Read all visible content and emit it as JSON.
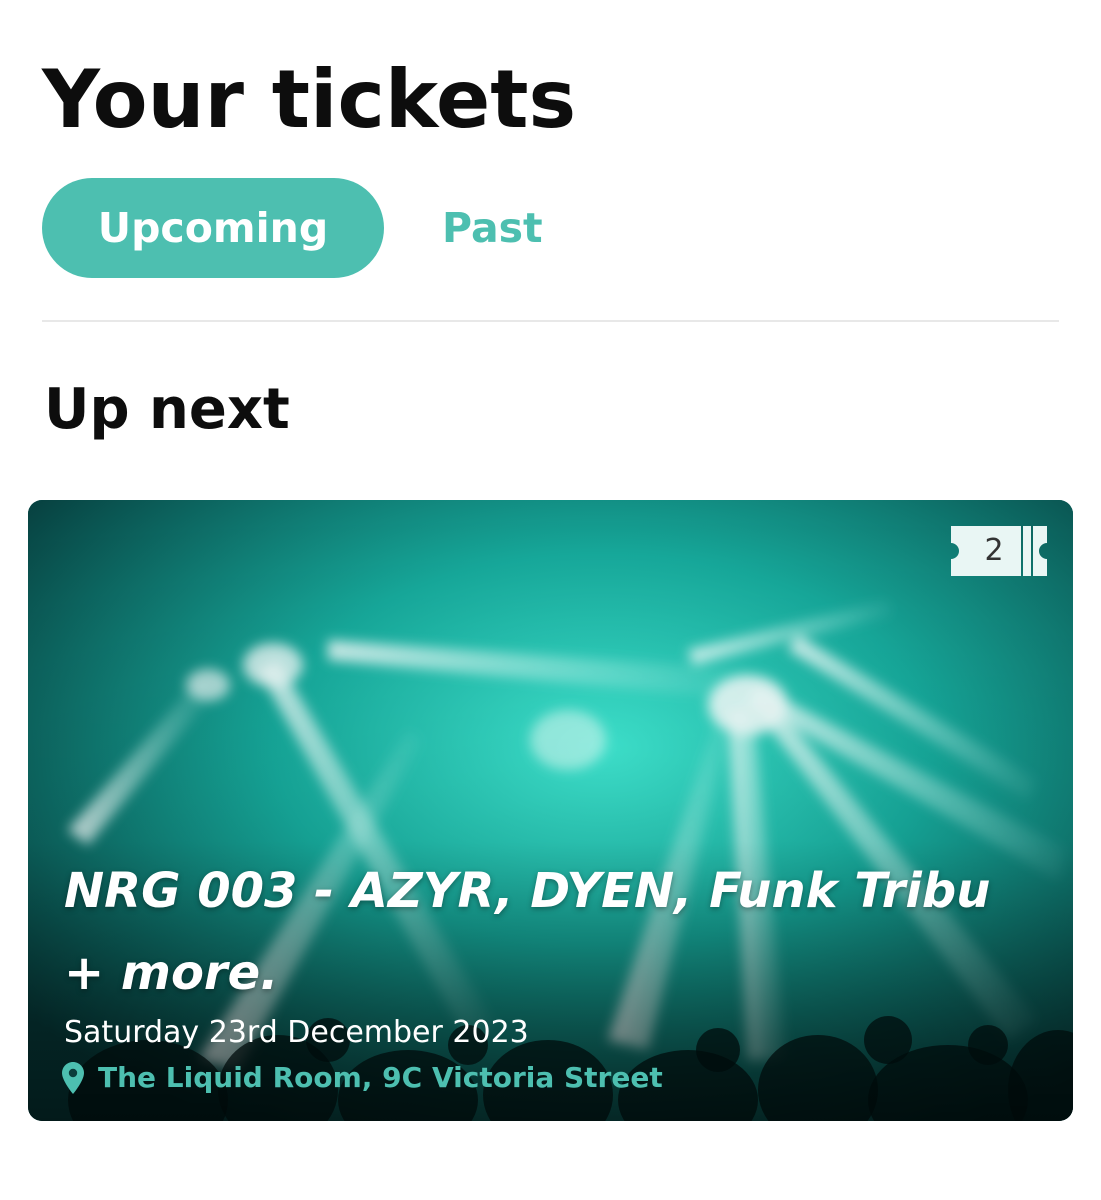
{
  "header": {
    "title": "Your tickets"
  },
  "tabs": [
    {
      "label": "Upcoming",
      "active": true
    },
    {
      "label": "Past",
      "active": false
    }
  ],
  "section": {
    "title": "Up next"
  },
  "event": {
    "title": "NRG 003 - AZYR, DYEN, Funk Tribu + more.",
    "date": "Saturday 23rd December 2023",
    "venue": "The Liquid Room, 9C Victoria Street",
    "ticket_count": "2",
    "ticket_icon": "ticket-icon",
    "venue_icon": "map-pin-icon"
  },
  "colors": {
    "accent": "#4dbfb0",
    "text": "#0d0d0d",
    "background": "#ffffff",
    "divider": "#e8e8e8"
  }
}
